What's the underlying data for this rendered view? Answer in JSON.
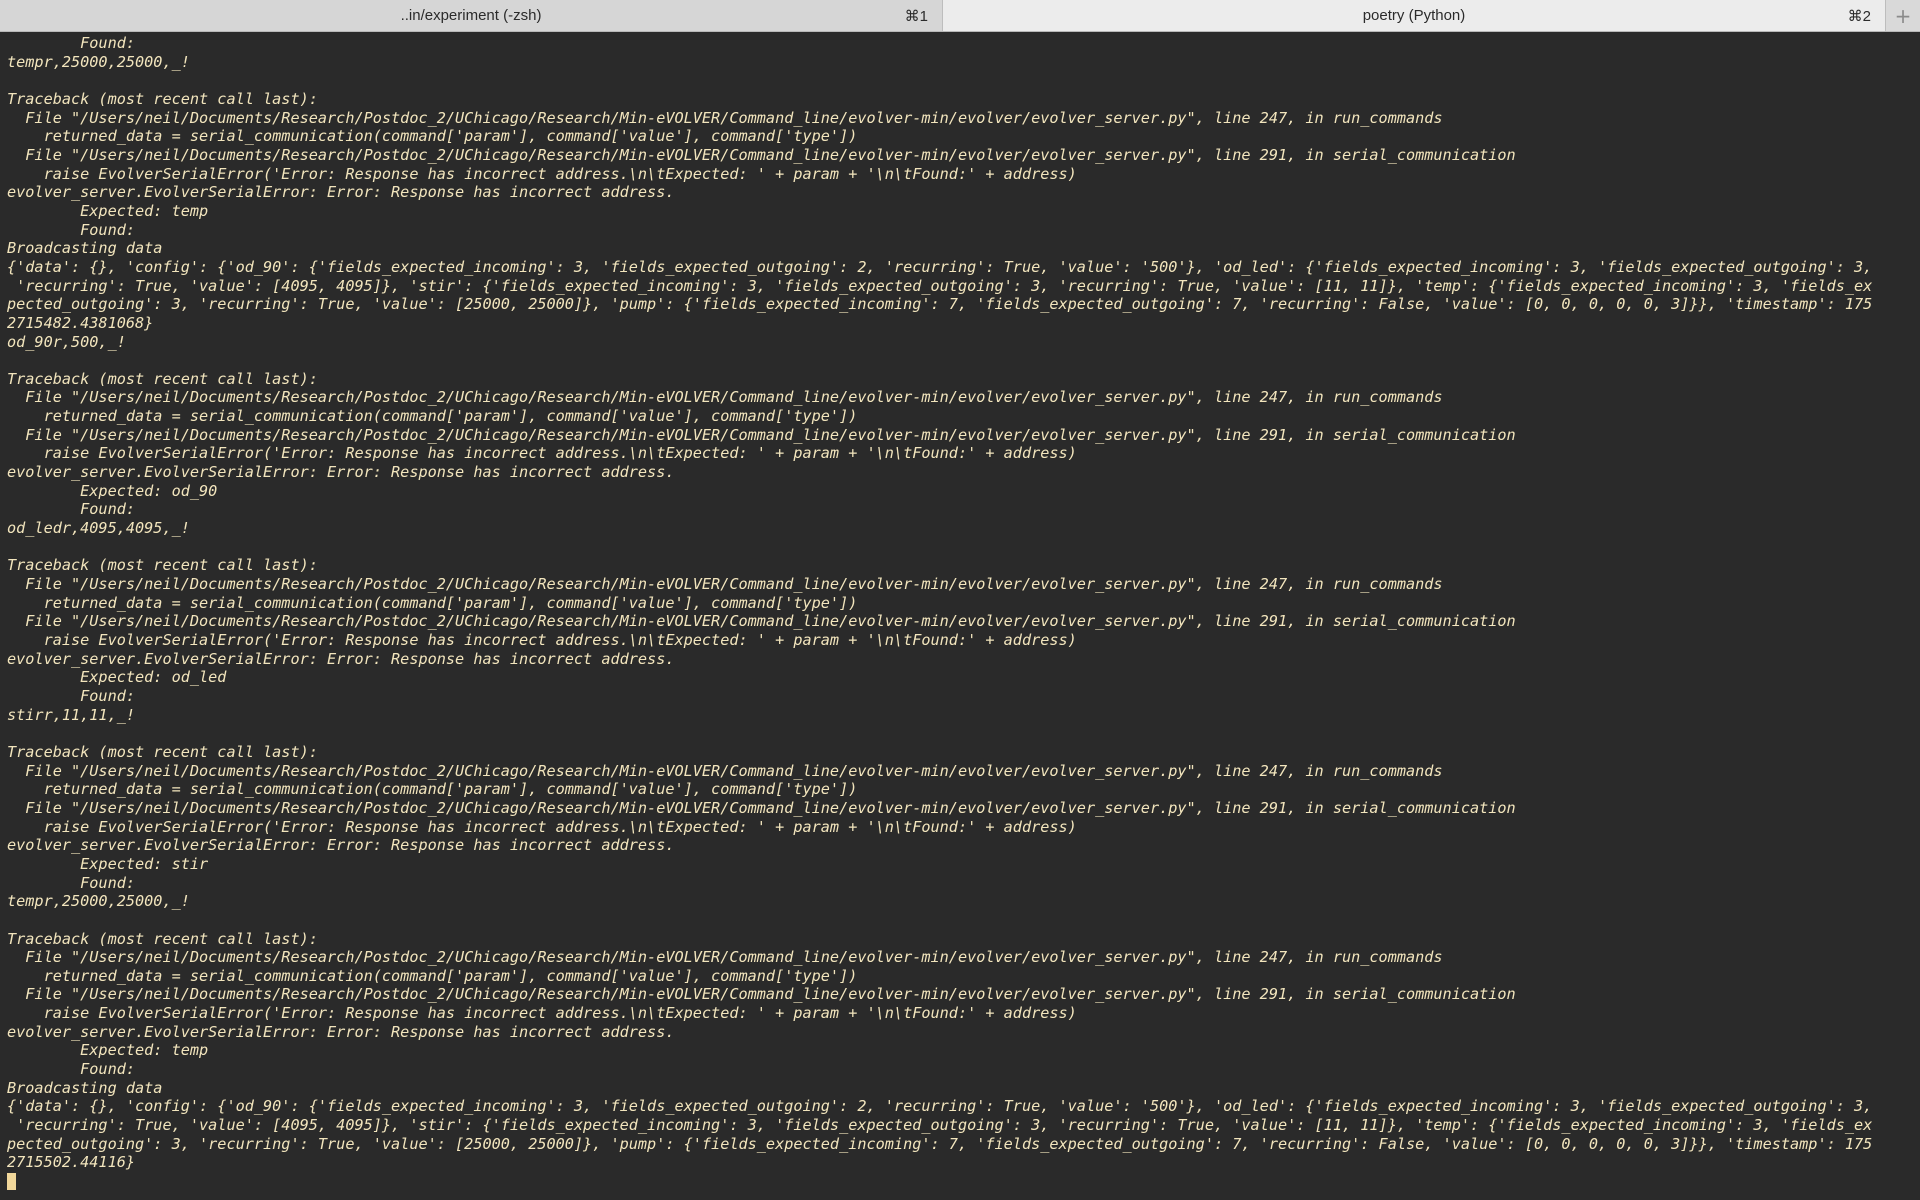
{
  "tabs": [
    {
      "label": "..in/experiment (-zsh)",
      "shortcut": "⌘1",
      "active": false
    },
    {
      "label": "poetry (Python)",
      "shortcut": "⌘2",
      "active": true
    }
  ],
  "new_tab_glyph": "+",
  "terminal": {
    "text_color": "#f2e5bd",
    "background": "#2a2a2a",
    "lines": [
      "        Found:",
      "tempr,25000,25000,_!",
      "",
      "Traceback (most recent call last):",
      "  File \"/Users/neil/Documents/Research/Postdoc_2/UChicago/Research/Min-eVOLVER/Command_line/evolver-min/evolver/evolver_server.py\", line 247, in run_commands",
      "    returned_data = serial_communication(command['param'], command['value'], command['type'])",
      "  File \"/Users/neil/Documents/Research/Postdoc_2/UChicago/Research/Min-eVOLVER/Command_line/evolver-min/evolver/evolver_server.py\", line 291, in serial_communication",
      "    raise EvolverSerialError('Error: Response has incorrect address.\\n\\tExpected: ' + param + '\\n\\tFound:' + address)",
      "evolver_server.EvolverSerialError: Error: Response has incorrect address.",
      "        Expected: temp",
      "        Found:",
      "Broadcasting data",
      "{'data': {}, 'config': {'od_90': {'fields_expected_incoming': 3, 'fields_expected_outgoing': 2, 'recurring': True, 'value': '500'}, 'od_led': {'fields_expected_incoming': 3, 'fields_expected_outgoing': 3,",
      " 'recurring': True, 'value': [4095, 4095]}, 'stir': {'fields_expected_incoming': 3, 'fields_expected_outgoing': 3, 'recurring': True, 'value': [11, 11]}, 'temp': {'fields_expected_incoming': 3, 'fields_ex",
      "pected_outgoing': 3, 'recurring': True, 'value': [25000, 25000]}, 'pump': {'fields_expected_incoming': 7, 'fields_expected_outgoing': 7, 'recurring': False, 'value': [0, 0, 0, 0, 0, 3]}}, 'timestamp': 175",
      "2715482.4381068}",
      "od_90r,500,_!",
      "",
      "Traceback (most recent call last):",
      "  File \"/Users/neil/Documents/Research/Postdoc_2/UChicago/Research/Min-eVOLVER/Command_line/evolver-min/evolver/evolver_server.py\", line 247, in run_commands",
      "    returned_data = serial_communication(command['param'], command['value'], command['type'])",
      "  File \"/Users/neil/Documents/Research/Postdoc_2/UChicago/Research/Min-eVOLVER/Command_line/evolver-min/evolver/evolver_server.py\", line 291, in serial_communication",
      "    raise EvolverSerialError('Error: Response has incorrect address.\\n\\tExpected: ' + param + '\\n\\tFound:' + address)",
      "evolver_server.EvolverSerialError: Error: Response has incorrect address.",
      "        Expected: od_90",
      "        Found:",
      "od_ledr,4095,4095,_!",
      "",
      "Traceback (most recent call last):",
      "  File \"/Users/neil/Documents/Research/Postdoc_2/UChicago/Research/Min-eVOLVER/Command_line/evolver-min/evolver/evolver_server.py\", line 247, in run_commands",
      "    returned_data = serial_communication(command['param'], command['value'], command['type'])",
      "  File \"/Users/neil/Documents/Research/Postdoc_2/UChicago/Research/Min-eVOLVER/Command_line/evolver-min/evolver/evolver_server.py\", line 291, in serial_communication",
      "    raise EvolverSerialError('Error: Response has incorrect address.\\n\\tExpected: ' + param + '\\n\\tFound:' + address)",
      "evolver_server.EvolverSerialError: Error: Response has incorrect address.",
      "        Expected: od_led",
      "        Found:",
      "stirr,11,11,_!",
      "",
      "Traceback (most recent call last):",
      "  File \"/Users/neil/Documents/Research/Postdoc_2/UChicago/Research/Min-eVOLVER/Command_line/evolver-min/evolver/evolver_server.py\", line 247, in run_commands",
      "    returned_data = serial_communication(command['param'], command['value'], command['type'])",
      "  File \"/Users/neil/Documents/Research/Postdoc_2/UChicago/Research/Min-eVOLVER/Command_line/evolver-min/evolver/evolver_server.py\", line 291, in serial_communication",
      "    raise EvolverSerialError('Error: Response has incorrect address.\\n\\tExpected: ' + param + '\\n\\tFound:' + address)",
      "evolver_server.EvolverSerialError: Error: Response has incorrect address.",
      "        Expected: stir",
      "        Found:",
      "tempr,25000,25000,_!",
      "",
      "Traceback (most recent call last):",
      "  File \"/Users/neil/Documents/Research/Postdoc_2/UChicago/Research/Min-eVOLVER/Command_line/evolver-min/evolver/evolver_server.py\", line 247, in run_commands",
      "    returned_data = serial_communication(command['param'], command['value'], command['type'])",
      "  File \"/Users/neil/Documents/Research/Postdoc_2/UChicago/Research/Min-eVOLVER/Command_line/evolver-min/evolver/evolver_server.py\", line 291, in serial_communication",
      "    raise EvolverSerialError('Error: Response has incorrect address.\\n\\tExpected: ' + param + '\\n\\tFound:' + address)",
      "evolver_server.EvolverSerialError: Error: Response has incorrect address.",
      "        Expected: temp",
      "        Found:",
      "Broadcasting data",
      "{'data': {}, 'config': {'od_90': {'fields_expected_incoming': 3, 'fields_expected_outgoing': 2, 'recurring': True, 'value': '500'}, 'od_led': {'fields_expected_incoming': 3, 'fields_expected_outgoing': 3,",
      " 'recurring': True, 'value': [4095, 4095]}, 'stir': {'fields_expected_incoming': 3, 'fields_expected_outgoing': 3, 'recurring': True, 'value': [11, 11]}, 'temp': {'fields_expected_incoming': 3, 'fields_ex",
      "pected_outgoing': 3, 'recurring': True, 'value': [25000, 25000]}, 'pump': {'fields_expected_incoming': 7, 'fields_expected_outgoing': 7, 'recurring': False, 'value': [0, 0, 0, 0, 0, 3]}}, 'timestamp': 175",
      "2715502.44116}"
    ]
  }
}
